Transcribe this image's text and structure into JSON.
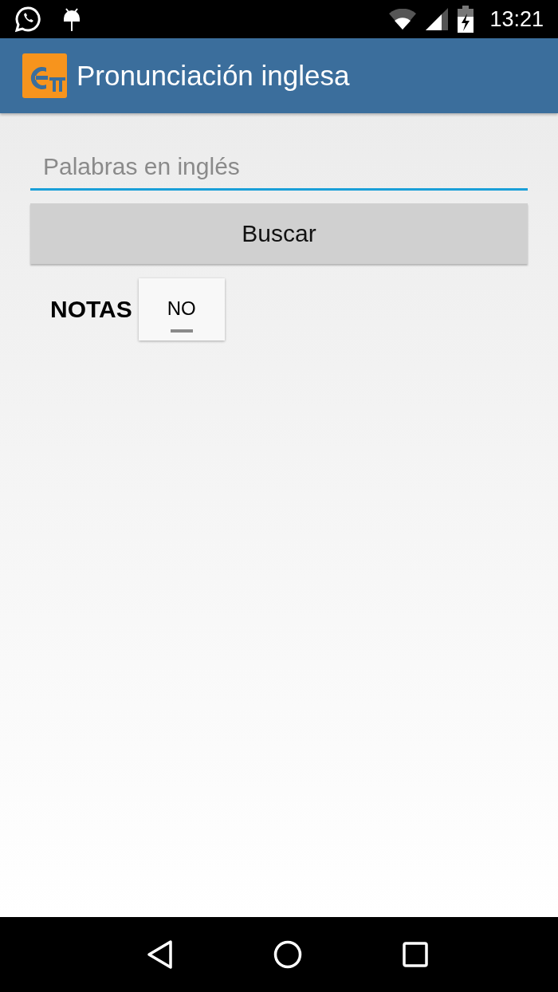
{
  "status_bar": {
    "time": "13:21"
  },
  "app_bar": {
    "title": "Pronunciación inglesa"
  },
  "search": {
    "placeholder": "Palabras en inglés"
  },
  "search_button": {
    "label": "Buscar"
  },
  "notes": {
    "label": "NOTAS",
    "toggle": {
      "text": "NO",
      "on": false
    }
  }
}
